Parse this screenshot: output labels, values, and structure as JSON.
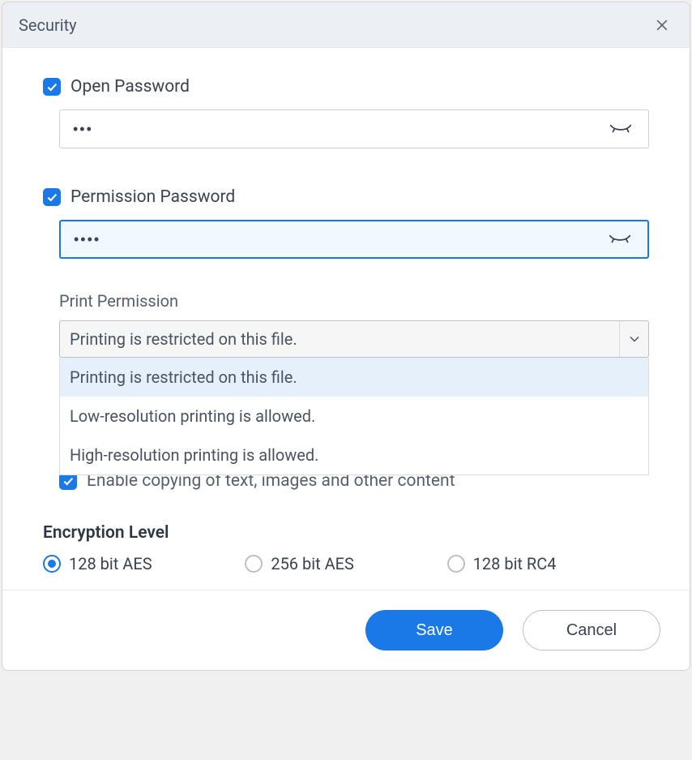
{
  "dialog": {
    "title": "Security"
  },
  "openPassword": {
    "label": "Open Password",
    "checked": true,
    "value": "•••"
  },
  "permissionPassword": {
    "label": "Permission Password",
    "checked": true,
    "value": "••••"
  },
  "printPermission": {
    "label": "Print Permission",
    "selected": "Printing is restricted on this file.",
    "options": [
      "Printing is restricted on this file.",
      "Low-resolution printing is allowed.",
      "High-resolution printing is allowed."
    ]
  },
  "enableCopying": {
    "label": "Enable copying of text, images and other content",
    "checked": true
  },
  "encryption": {
    "title": "Encryption Level",
    "options": [
      {
        "label": "128 bit AES",
        "checked": true
      },
      {
        "label": "256 bit AES",
        "checked": false
      },
      {
        "label": "128 bit RC4",
        "checked": false
      }
    ]
  },
  "footer": {
    "save": "Save",
    "cancel": "Cancel"
  }
}
